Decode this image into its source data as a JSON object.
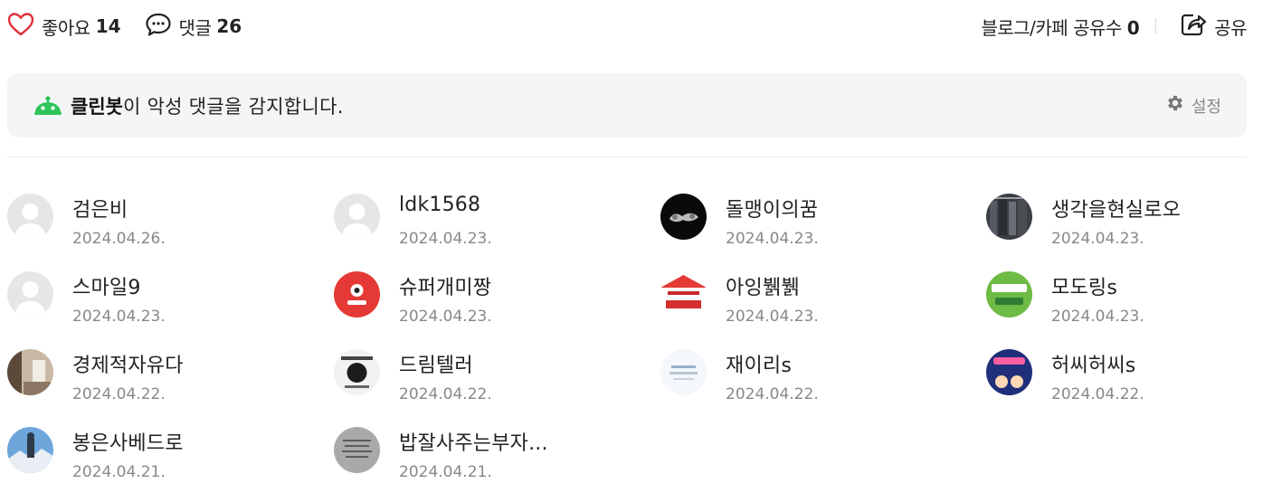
{
  "reactions": {
    "like_label": "좋아요",
    "like_count": "14",
    "comment_label": "댓글",
    "comment_count": "26",
    "share_count_label": "블로그/카페 공유수",
    "share_count": "0",
    "share_label": "공유"
  },
  "cleanbot": {
    "name": "클린봇",
    "message": "이 악성 댓글을 감지합니다.",
    "settings_label": "설정"
  },
  "likers": [
    {
      "name": "검은비",
      "date": "2024.04.26.",
      "avatar": "default"
    },
    {
      "name": "ldk1568",
      "date": "2024.04.23.",
      "avatar": "default"
    },
    {
      "name": "돌맹이의꿈",
      "date": "2024.04.23.",
      "avatar": "black"
    },
    {
      "name": "생각을현실로오",
      "date": "2024.04.23.",
      "avatar": "clothes"
    },
    {
      "name": "스마일9",
      "date": "2024.04.23.",
      "avatar": "default"
    },
    {
      "name": "슈퍼개미짱",
      "date": "2024.04.23.",
      "avatar": "red"
    },
    {
      "name": "아잉뷁뷁",
      "date": "2024.04.23.",
      "avatar": "promo-red"
    },
    {
      "name": "모도링s",
      "date": "2024.04.23.",
      "avatar": "green"
    },
    {
      "name": "경제적자유다",
      "date": "2024.04.22.",
      "avatar": "room"
    },
    {
      "name": "드림텔러",
      "date": "2024.04.22.",
      "avatar": "sketch"
    },
    {
      "name": "재이리s",
      "date": "2024.04.22.",
      "avatar": "light"
    },
    {
      "name": "허씨허씨s",
      "date": "2024.04.22.",
      "avatar": "navy"
    },
    {
      "name": "봉은사베드로",
      "date": "2024.04.21.",
      "avatar": "mountain"
    },
    {
      "name": "밥잘사주는부자...",
      "date": "2024.04.21.",
      "avatar": "gray-text"
    }
  ],
  "colors": {
    "heart": "#e0323c",
    "cleanbot_green": "#2fc55a",
    "panel_bg": "#f4f5f7",
    "date_gray": "#888888"
  }
}
